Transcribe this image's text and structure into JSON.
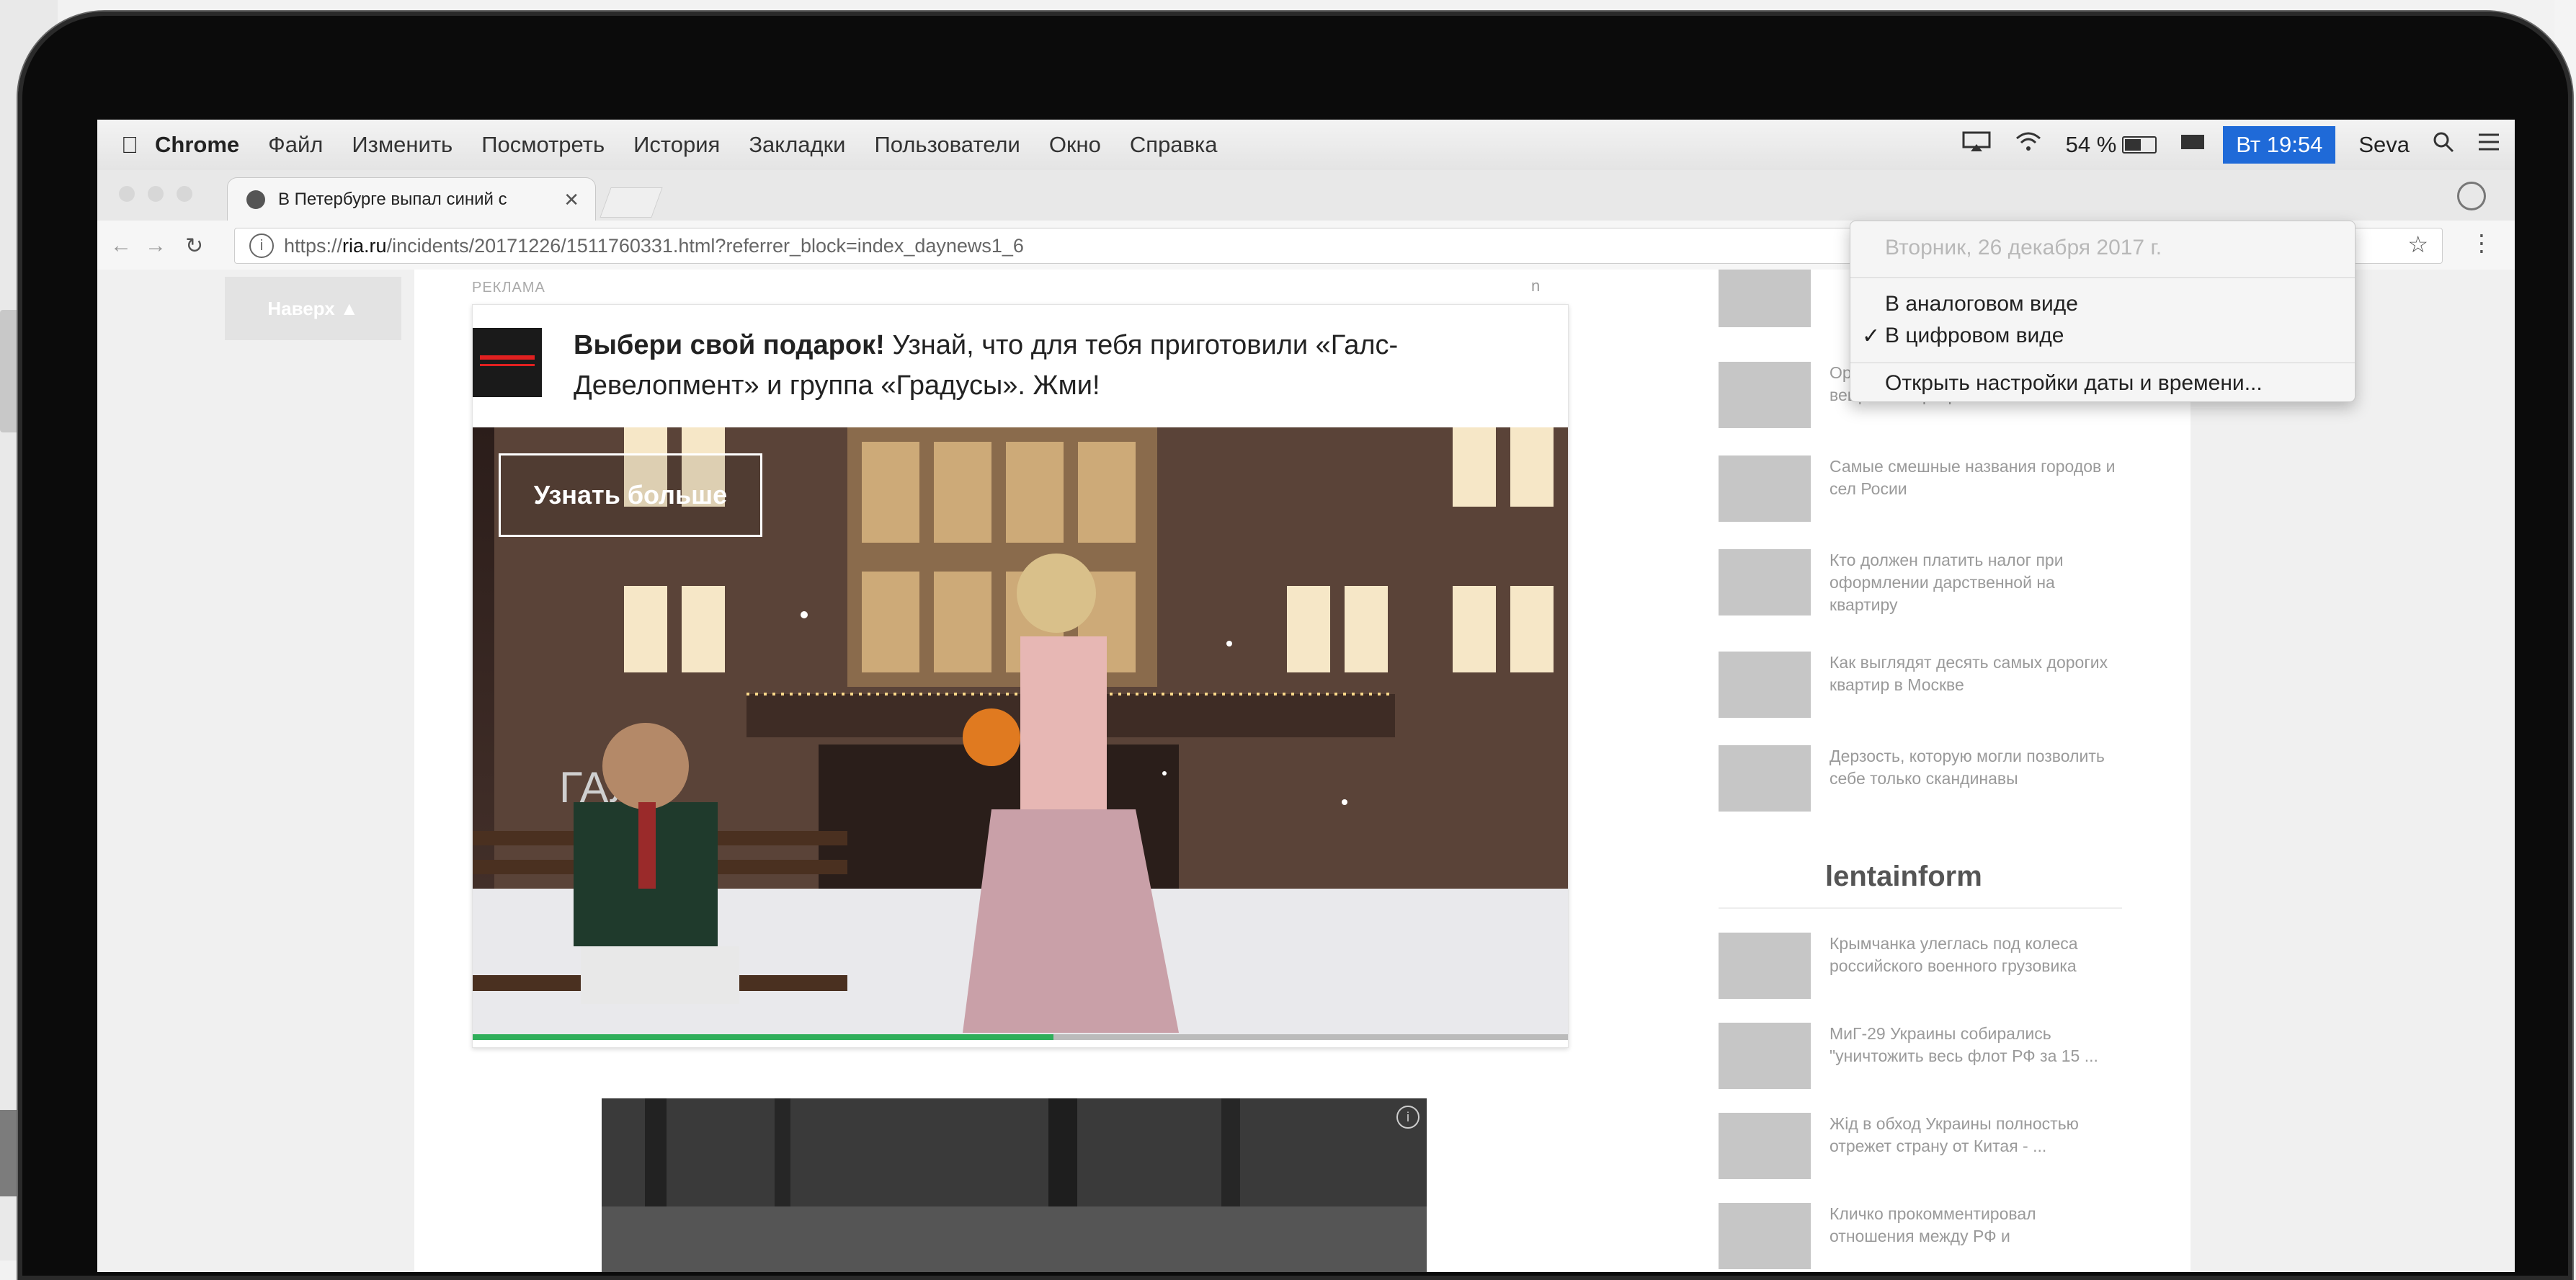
{
  "menubar": {
    "app_name": "Chrome",
    "items": [
      "Файл",
      "Изменить",
      "Посмотреть",
      "История",
      "Закладки",
      "Пользователи",
      "Окно",
      "Справка"
    ],
    "battery": "54 %",
    "battery_level_percent": 54,
    "clock": "Вт 19:54",
    "user": "Seva"
  },
  "browser": {
    "tab_title": "В Петербурге выпал синий с",
    "url_prefix": "https://",
    "url_domain": "ria.ru",
    "url_path": "/incidents/20171226/1511760331.html?referrer_block=index_daynews1_6"
  },
  "page": {
    "back_to_top": "Наверх ▲",
    "ad_label": "РЕКЛАМА",
    "ad_marker": "n",
    "ad": {
      "headline_bold": "Выбери свой подарок!",
      "headline_rest": " Узнай, что для тебя приготовили «Галс-Девелопмент» и группа «Градусы». Жми!",
      "cta": "Узнать больше",
      "video_progress_percent": 53
    },
    "ad2_info": "i"
  },
  "sidebar": {
    "items": [
      "Оригинальные способы хранения вещей в квартире",
      "Самые смешные названия городов и сел Росии",
      "Кто должен платить налог при оформлении дарственной на квартиру",
      "Как выглядят десять самых дорогих квартир в Москве",
      "Дерзость, которую могли позволить себе только скандинавы"
    ],
    "brand": "lentainform",
    "lenta_items": [
      "Крымчанка улеглась под колеса российского военного грузовика",
      "МиГ-29 Украины собирались \"уничтожить весь флот РФ за 15 ...",
      "Жiд в обход Украины полностью отрежет страну от Китая - ...",
      "Кличко прокомментировал отношения между РФ и"
    ]
  },
  "date_menu": {
    "date": "Вторник, 26 декабря 2017 г.",
    "option_analog": "В аналоговом виде",
    "option_digital": "В цифровом виде",
    "open_settings": "Открыть настройки даты и времени..."
  }
}
